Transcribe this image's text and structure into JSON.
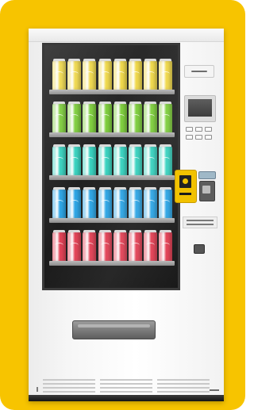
{
  "colors": {
    "background_frame": "#f7c400",
    "card_reader": "#f2c200",
    "shelf_row_colors": [
      "#f0d94c",
      "#7fcf3e",
      "#39d3c0",
      "#2ea6e6",
      "#e34155"
    ]
  },
  "vending_machine": {
    "shelf_rows": [
      {
        "flavor_color": "#f0d94c",
        "can_count": 8
      },
      {
        "flavor_color": "#7fcf3e",
        "can_count": 8
      },
      {
        "flavor_color": "#39d3c0",
        "can_count": 8
      },
      {
        "flavor_color": "#2ea6e6",
        "can_count": 8
      },
      {
        "flavor_color": "#e34155",
        "can_count": 8
      }
    ]
  }
}
